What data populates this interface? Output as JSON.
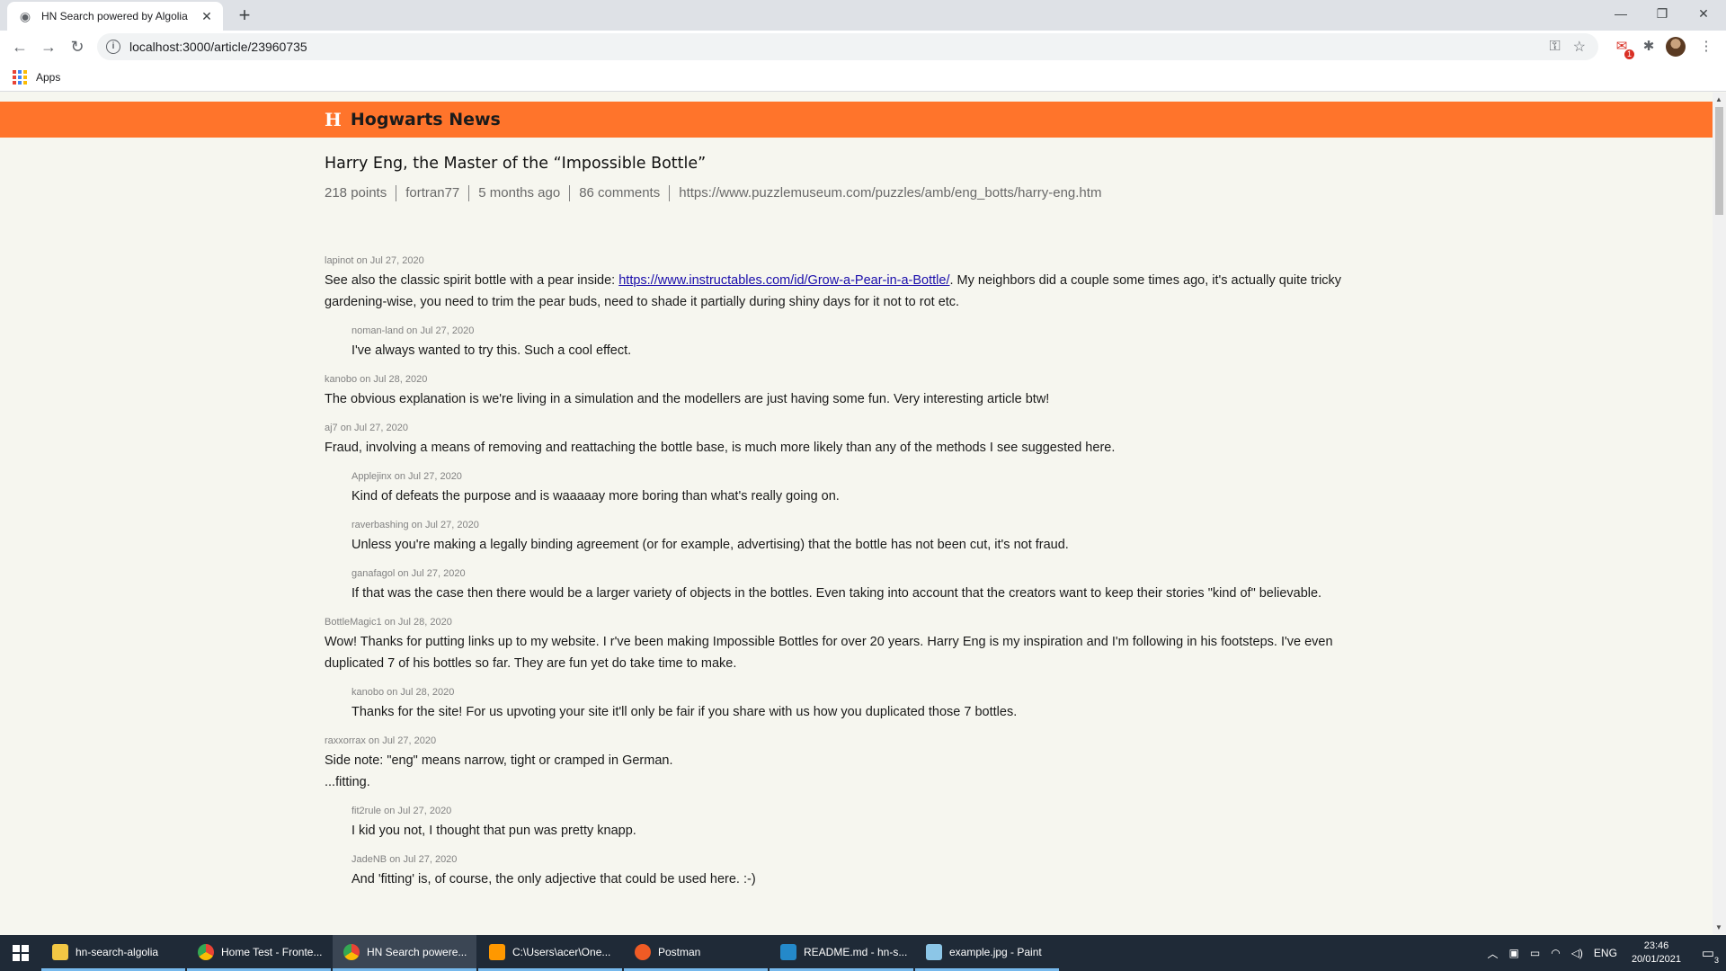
{
  "browser": {
    "tab_title": "HN Search powered by Algolia",
    "tab_close": "✕",
    "new_tab": "+",
    "url": "localhost:3000/article/23960735",
    "bookmarks_apps_label": "Apps",
    "mail_badge": "1"
  },
  "site": {
    "logo": "H",
    "name": "Hogwarts News"
  },
  "article": {
    "title": "Harry Eng, the Master of the “Impossible Bottle”",
    "points": "218 points",
    "author": "fortran77",
    "age": "5 months ago",
    "comments": "86 comments",
    "url": "https://www.puzzlemuseum.com/puzzles/amb/eng_botts/harry-eng.htm"
  },
  "comments": [
    {
      "meta": "lapinot on Jul 27, 2020",
      "pre": "See also the classic spirit bottle with a pear inside: ",
      "link": "https://www.instructables.com/id/Grow-a-Pear-in-a-Bottle/",
      "post": ". My neighbors did a couple some times ago, it's actually quite tricky gardening-wise, you need to trim the pear buds, need to shade it partially during shiny days for it not to rot etc."
    },
    {
      "meta": "noman-land on Jul 27, 2020",
      "text": "I've always wanted to try this. Such a cool effect."
    },
    {
      "meta": "kanobo on Jul 28, 2020",
      "text": "The obvious explanation is we're living in a simulation and the modellers are just having some fun. Very interesting article btw!"
    },
    {
      "meta": "aj7 on Jul 27, 2020",
      "text": "Fraud, involving a means of removing and reattaching the bottle base, is much more likely than any of the methods I see suggested here."
    },
    {
      "meta": "Applejinx on Jul 27, 2020",
      "text": "Kind of defeats the purpose and is waaaaay more boring than what's really going on."
    },
    {
      "meta": "raverbashing on Jul 27, 2020",
      "text": "Unless you're making a legally binding agreement (or for example, advertising) that the bottle has not been cut, it's not fraud."
    },
    {
      "meta": "ganafagol on Jul 27, 2020",
      "text": "If that was the case then there would be a larger variety of objects in the bottles. Even taking into account that the creators want to keep their stories \"kind of\" believable."
    },
    {
      "meta": "BottleMagic1 on Jul 28, 2020",
      "text": "Wow! Thanks for putting links up to my website. I r've been making Impossible Bottles for over 20 years. Harry Eng is my inspiration and I'm following in his footsteps. I've even duplicated 7 of his bottles so far. They are fun yet do take time to make."
    },
    {
      "meta": "kanobo on Jul 28, 2020",
      "text": "Thanks for the site! For us upvoting your site it'll only be fair if you share with us how you duplicated those 7 bottles."
    },
    {
      "meta": "raxxorrax on Jul 27, 2020",
      "text": "Side note: \"eng\" means narrow, tight or cramped in German.",
      "text2": "...fitting."
    },
    {
      "meta": "fit2rule on Jul 27, 2020",
      "text": "I kid you not, I thought that pun was pretty knapp."
    },
    {
      "meta": "JadeNB on Jul 27, 2020",
      "text": "And 'fitting' is, of course, the only adjective that could be used here. :-)"
    }
  ],
  "taskbar": {
    "items": [
      {
        "label": "hn-search-algolia"
      },
      {
        "label": "Home Test - Fronte..."
      },
      {
        "label": "HN Search powere..."
      },
      {
        "label": "C:\\Users\\acer\\One..."
      },
      {
        "label": "Postman"
      },
      {
        "label": "README.md - hn-s..."
      },
      {
        "label": "example.jpg - Paint"
      }
    ],
    "language": "ENG",
    "time": "23:46",
    "date": "20/01/2021",
    "notification_count": "3"
  },
  "colors": {
    "header": "#ff742b",
    "link": "#1a0dab",
    "taskbar": "#1f2a37"
  }
}
